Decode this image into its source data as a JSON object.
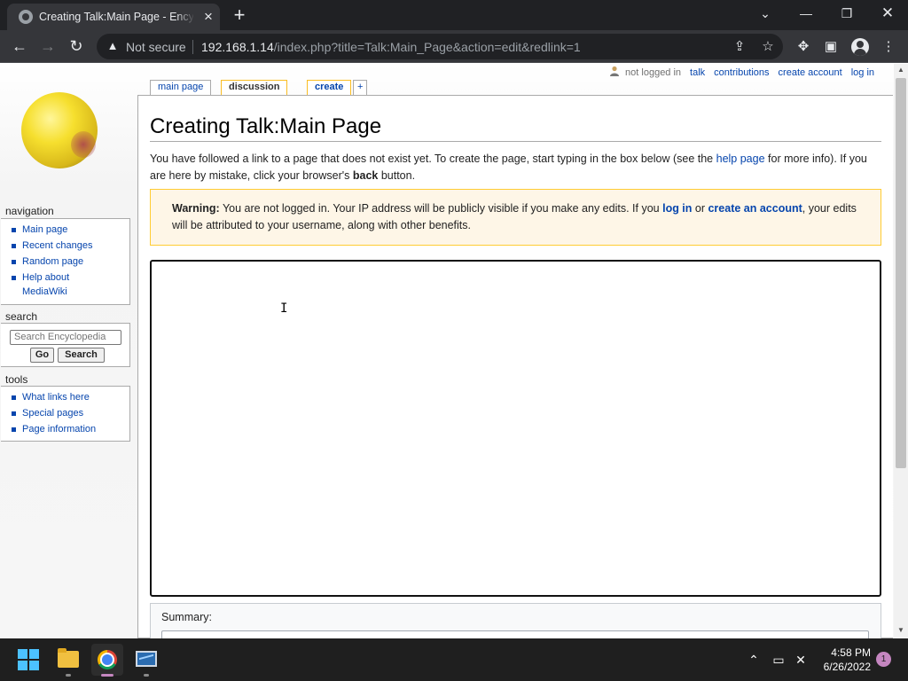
{
  "browser": {
    "tab_title": "Creating Talk:Main Page - Encyclopedia",
    "security_label": "Not secure",
    "url_host": "192.168.1.14",
    "url_path": "/index.php?title=Talk:Main_Page&action=edit&redlink=1",
    "icons": [
      "back-arrow-icon",
      "forward-arrow-icon",
      "reload-icon",
      "warning-triangle-icon",
      "share-icon",
      "star-icon",
      "puzzle-icon",
      "side-panel-icon",
      "profile-icon",
      "kebab-menu-icon"
    ]
  },
  "personal_tools": {
    "anon_label": "not logged in",
    "talk": "talk",
    "contributions": "contributions",
    "create_account": "create account",
    "log_in": "log in"
  },
  "page_tabs": {
    "main_page": "main page",
    "discussion": "discussion",
    "create": "create",
    "plus": "+"
  },
  "sidebar": {
    "navigation_heading": "navigation",
    "navigation_items": [
      "Main page",
      "Recent changes",
      "Random page",
      "Help about",
      "MediaWiki"
    ],
    "search_heading": "search",
    "search_placeholder": "Search Encyclopedia",
    "go_label": "Go",
    "search_label": "Search",
    "tools_heading": "tools",
    "tools_items": [
      "What links here",
      "Special pages",
      "Page information"
    ]
  },
  "content": {
    "title": "Creating Talk:Main Page",
    "intro_before_link": "You have followed a link to a page that does not exist yet. To create the page, start typing in the box below (see the ",
    "intro_link": "help page",
    "intro_after_link": " for more info). If you are here by mistake, click your browser's ",
    "intro_bold": "back",
    "intro_end": " button.",
    "warning_label": "Warning:",
    "warning_text_1": " You are not logged in. Your IP address will be publicly visible if you make any edits. If you ",
    "warning_link_login": "log in",
    "warning_text_2": " or ",
    "warning_link_account": "create an account",
    "warning_text_3": ", your edits will be attributed to your username, along with other benefits.",
    "editor_value": "",
    "summary_label": "Summary:"
  },
  "taskbar": {
    "time": "4:58 PM",
    "date": "6/26/2022",
    "notification_count": "1"
  },
  "colors": {
    "link": "#0645ad",
    "warning_bg": "#fef6e7",
    "warning_border": "#ffcc33",
    "chrome_dark": "#202124",
    "chrome_toolbar": "#35363a"
  }
}
